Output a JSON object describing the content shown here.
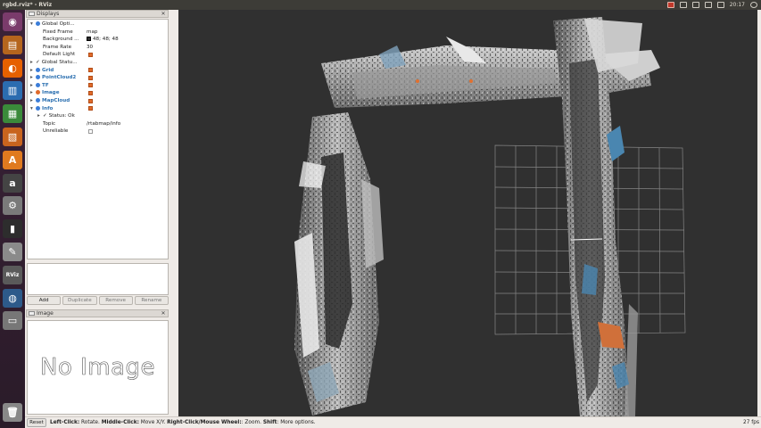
{
  "system": {
    "window_title": "rgbd.rviz* - RViz",
    "clock": "20:17"
  },
  "launcher": {
    "items": [
      {
        "name": "dash-home-icon",
        "color": "#7a3b6b",
        "glyph": "◉"
      },
      {
        "name": "file-manager-icon",
        "color": "#b5651d",
        "glyph": "▤"
      },
      {
        "name": "firefox-icon",
        "color": "#e66000",
        "glyph": "◐"
      },
      {
        "name": "libreoffice-writer-icon",
        "color": "#2b6cb0",
        "glyph": "▥"
      },
      {
        "name": "libreoffice-calc-icon",
        "color": "#3a8a3a",
        "glyph": "▦"
      },
      {
        "name": "libreoffice-impress-icon",
        "color": "#c8641e",
        "glyph": "▧"
      },
      {
        "name": "software-center-icon",
        "color": "#e07a1f",
        "glyph": "A"
      },
      {
        "name": "amazon-icon",
        "color": "#444444",
        "glyph": "a"
      },
      {
        "name": "system-settings-icon",
        "color": "#7a7a7a",
        "glyph": "⚙"
      },
      {
        "name": "terminal-icon",
        "color": "#2d2d2d",
        "glyph": "▮"
      },
      {
        "name": "text-editor-icon",
        "color": "#8a8a8a",
        "glyph": "✎"
      },
      {
        "name": "rviz-icon",
        "color": "#5a5a5a",
        "glyph": "RViz"
      },
      {
        "name": "app-icon",
        "color": "#2d5a8a",
        "glyph": "◍"
      },
      {
        "name": "disk-icon",
        "color": "#777777",
        "glyph": "▭"
      },
      {
        "name": "trash-icon",
        "color": "#888888",
        "glyph": "🗑"
      }
    ]
  },
  "displays_panel": {
    "title": "Displays",
    "rows": [
      {
        "label": "Global Opti...",
        "indent": 0,
        "arrow": "▾",
        "icon": "#3b7dd8",
        "value": ""
      },
      {
        "label": "Fixed Frame",
        "indent": 1,
        "arrow": "",
        "icon": "",
        "value": "map"
      },
      {
        "label": "Background ...",
        "indent": 1,
        "arrow": "",
        "icon": "",
        "value": "48; 48; 48",
        "swatch": true
      },
      {
        "label": "Frame Rate",
        "indent": 1,
        "arrow": "",
        "icon": "",
        "value": "30"
      },
      {
        "label": "Default Light",
        "indent": 1,
        "arrow": "",
        "icon": "",
        "checkbox": "on"
      },
      {
        "label": "Global Statu...",
        "indent": 0,
        "arrow": "▸",
        "icon": "check",
        "value": ""
      },
      {
        "label": "Grid",
        "indent": 0,
        "arrow": "▸",
        "icon": "#3b7dd8",
        "blue": true,
        "checkbox": "on"
      },
      {
        "label": "PointCloud2",
        "indent": 0,
        "arrow": "▸",
        "icon": "#3b7dd8",
        "blue": true,
        "checkbox": "on"
      },
      {
        "label": "TF",
        "indent": 0,
        "arrow": "▸",
        "icon": "#3b7dd8",
        "blue": true,
        "checkbox": "on"
      },
      {
        "label": "Image",
        "indent": 0,
        "arrow": "▸",
        "icon": "#e06a2a",
        "blue": true,
        "checkbox": "on"
      },
      {
        "label": "MapCloud",
        "indent": 0,
        "arrow": "▸",
        "icon": "#3b7dd8",
        "blue": true,
        "checkbox": "on"
      },
      {
        "label": "Info",
        "indent": 0,
        "arrow": "▾",
        "icon": "#3b7dd8",
        "blue": true,
        "checkbox": "on"
      },
      {
        "label": "Status: Ok",
        "indent": 1,
        "arrow": "▸",
        "icon": "check",
        "value": ""
      },
      {
        "label": "Topic",
        "indent": 1,
        "arrow": "",
        "icon": "",
        "value": "/rtabmap/info"
      },
      {
        "label": "Unreliable",
        "indent": 1,
        "arrow": "",
        "icon": "",
        "checkbox": "off"
      }
    ],
    "buttons": {
      "add": "Add",
      "duplicate": "Duplicate",
      "remove": "Remove",
      "rename": "Rename"
    }
  },
  "image_panel": {
    "title": "Image",
    "placeholder": "No Image"
  },
  "status_bar": {
    "reset": "Reset",
    "hint_parts": [
      {
        "text": "Left-Click:",
        "bold": true
      },
      {
        "text": " Rotate. ",
        "bold": false
      },
      {
        "text": "Middle-Click:",
        "bold": true
      },
      {
        "text": " Move X/Y. ",
        "bold": false
      },
      {
        "text": "Right-Click/Mouse Wheel:",
        "bold": true
      },
      {
        "text": ": Zoom. ",
        "bold": false
      },
      {
        "text": "Shift",
        "bold": true
      },
      {
        "text": ": More options.",
        "bold": false
      }
    ],
    "fps": "27 fps"
  },
  "colors": {
    "viewport_background": "#303030",
    "checkbox_on": "#e06a2a",
    "accent_blue": "#2a6fb0"
  }
}
